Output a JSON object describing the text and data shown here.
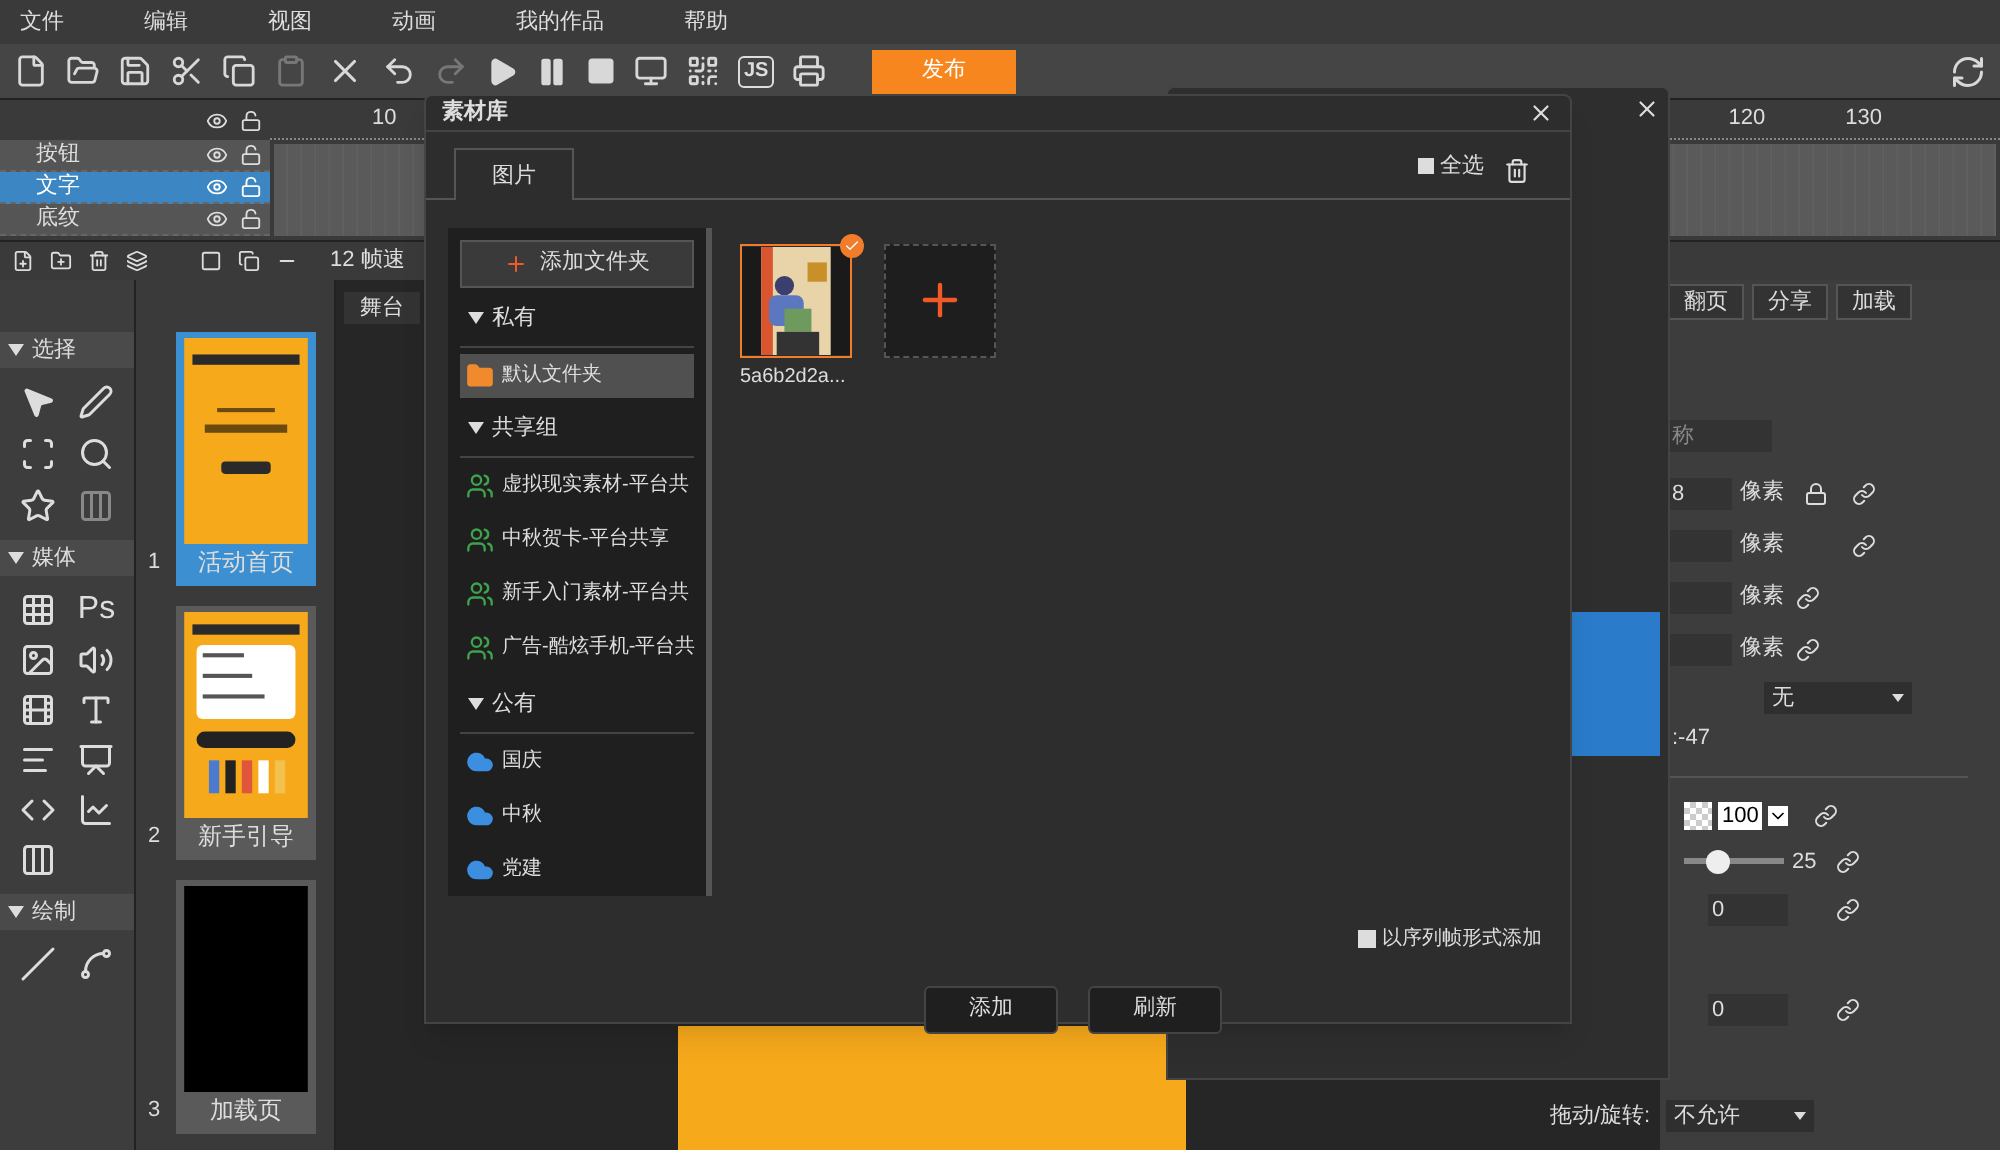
{
  "menu": [
    "文件",
    "编辑",
    "视图",
    "动画",
    "我的作品",
    "帮助"
  ],
  "toolbar": {
    "js_label": "JS",
    "publish": "发布"
  },
  "timeline": {
    "ruler": [
      "10",
      "120",
      "130"
    ],
    "layers": [
      {
        "name": "按钮",
        "selected": false
      },
      {
        "name": "文字",
        "selected": true
      },
      {
        "name": "底纹",
        "selected": false
      }
    ],
    "fps": "12 帧速"
  },
  "tools": {
    "sections": [
      {
        "title": "选择",
        "expanded": true
      },
      {
        "title": "媒体",
        "expanded": true
      },
      {
        "title": "绘制",
        "expanded": true
      }
    ],
    "ps_label": "Ps"
  },
  "pages": [
    {
      "number": "1",
      "title": "活动首页",
      "selected": true,
      "kind": "cover"
    },
    {
      "number": "2",
      "title": "新手引导",
      "selected": false,
      "kind": "guide"
    },
    {
      "number": "3",
      "title": "加载页",
      "selected": false,
      "kind": "blank"
    }
  ],
  "stage_tab": "舞台",
  "dialog": {
    "title": "素材库",
    "tabs": [
      {
        "label": "图片",
        "selected": true
      }
    ],
    "select_all": {
      "label": "全选",
      "checked": false
    },
    "add_folder": "添加文件夹",
    "groups": [
      {
        "title": "私有",
        "expanded": true,
        "kind": "private",
        "items": [
          {
            "name": "默认文件夹",
            "selected": true
          }
        ]
      },
      {
        "title": "共享组",
        "expanded": true,
        "kind": "shared",
        "items": [
          {
            "name": "虚拟现实素材-平台共",
            "selected": false
          },
          {
            "name": "中秋贺卡-平台共享",
            "selected": false
          },
          {
            "name": "新手入门素材-平台共",
            "selected": false
          },
          {
            "name": "广告-酷炫手机-平台共",
            "selected": false
          }
        ]
      },
      {
        "title": "公有",
        "expanded": true,
        "kind": "public",
        "items": [
          {
            "name": "国庆",
            "selected": false
          },
          {
            "name": "中秋",
            "selected": false
          },
          {
            "name": "党建",
            "selected": false
          }
        ]
      }
    ],
    "assets": [
      {
        "name": "5a6b2d2a...",
        "selected": true
      }
    ],
    "sequence": {
      "label": "以序列帧形式添加",
      "checked": false
    },
    "buttons": [
      "添加",
      "刷新"
    ]
  },
  "properties": {
    "tabs": [
      "翻页",
      "分享",
      "加载"
    ],
    "name_placeholder": "称",
    "size_rows": [
      {
        "value": "8",
        "unit": "像素"
      },
      {
        "value": "",
        "unit": "像素"
      },
      {
        "value": "",
        "unit": "像素"
      },
      {
        "value": "",
        "unit": "像素"
      }
    ],
    "select": "无",
    "coord": ":-47",
    "opacity": "100",
    "slider": {
      "level": 0.28,
      "reading": "25"
    },
    "rotate_values": [
      "0",
      "0"
    ],
    "drag_label": "拖动/旋转:",
    "drag_value": "不允许"
  }
}
